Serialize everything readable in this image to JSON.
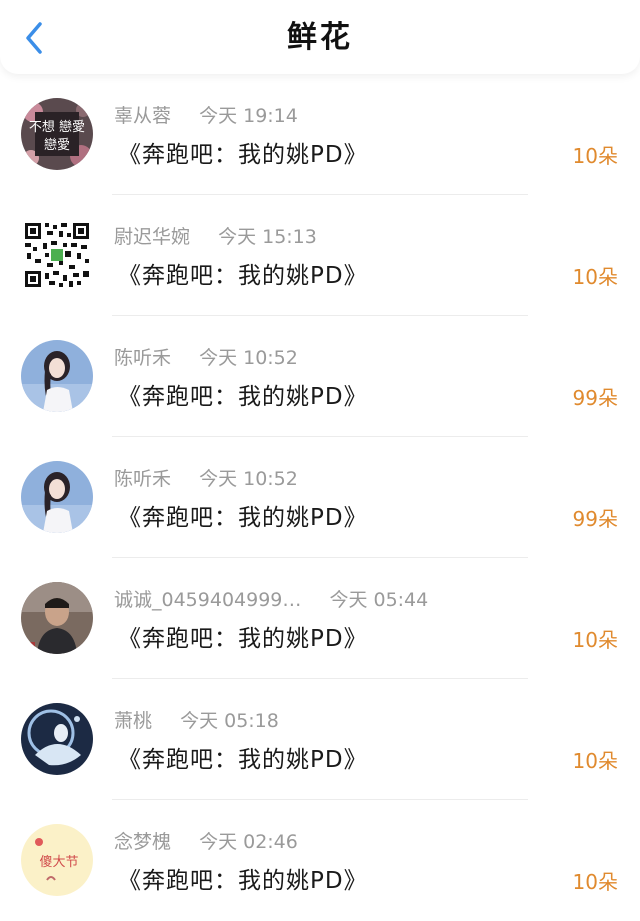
{
  "header": {
    "title": "鲜花",
    "back_icon": "chevron-left-icon",
    "accent": "#3b8ee8"
  },
  "colors": {
    "amount": "#e08a2e",
    "meta": "#9a9a9a"
  },
  "records": [
    {
      "name": "辜从蓉",
      "time": "今天 19:14",
      "show": "《奔跑吧：我的姚PD》",
      "amount": "10朵",
      "avatar_text": "不想 戀愛"
    },
    {
      "name": "尉迟华婉",
      "time": "今天 15:13",
      "show": "《奔跑吧：我的姚PD》",
      "amount": "10朵"
    },
    {
      "name": "陈听禾",
      "time": "今天 10:52",
      "show": "《奔跑吧：我的姚PD》",
      "amount": "99朵"
    },
    {
      "name": "陈听禾",
      "time": "今天 10:52",
      "show": "《奔跑吧：我的姚PD》",
      "amount": "99朵"
    },
    {
      "name": "诚诚_0459404999…",
      "time": "今天 05:44",
      "show": "《奔跑吧：我的姚PD》",
      "amount": "10朵"
    },
    {
      "name": "萧桃",
      "time": "今天 05:18",
      "show": "《奔跑吧：我的姚PD》",
      "amount": "10朵"
    },
    {
      "name": "念梦槐",
      "time": "今天 02:46",
      "show": "《奔跑吧：我的姚PD》",
      "amount": "10朵",
      "avatar_text": "傻大节"
    }
  ]
}
